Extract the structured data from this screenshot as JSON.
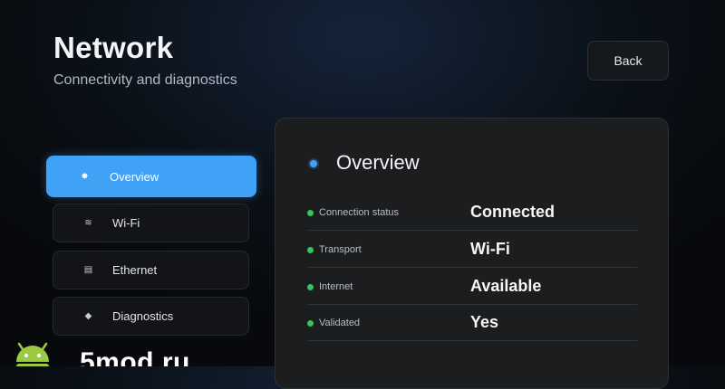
{
  "header": {
    "title": "Network",
    "subtitle": "Connectivity and diagnostics",
    "back_label": "Back"
  },
  "sidebar": {
    "items": [
      {
        "label": "Overview",
        "icon": "overview-icon",
        "glyph": "✸",
        "active": true
      },
      {
        "label": "Wi-Fi",
        "icon": "wifi-icon",
        "glyph": "≋",
        "active": false
      },
      {
        "label": "Ethernet",
        "icon": "ethernet-icon",
        "glyph": "▤",
        "active": false
      },
      {
        "label": "Diagnostics",
        "icon": "diagnostics-icon",
        "glyph": "◆",
        "active": false
      }
    ]
  },
  "panel": {
    "title": "Overview",
    "rows": [
      {
        "label": "Connection status",
        "value": "Connected"
      },
      {
        "label": "Transport",
        "value": "Wi-Fi"
      },
      {
        "label": "Internet",
        "value": "Available"
      },
      {
        "label": "Validated",
        "value": "Yes"
      }
    ]
  },
  "colors": {
    "accent": "#3fa2f6",
    "status_ok": "#36c45a"
  },
  "watermark": {
    "text": "5mod.ru"
  }
}
